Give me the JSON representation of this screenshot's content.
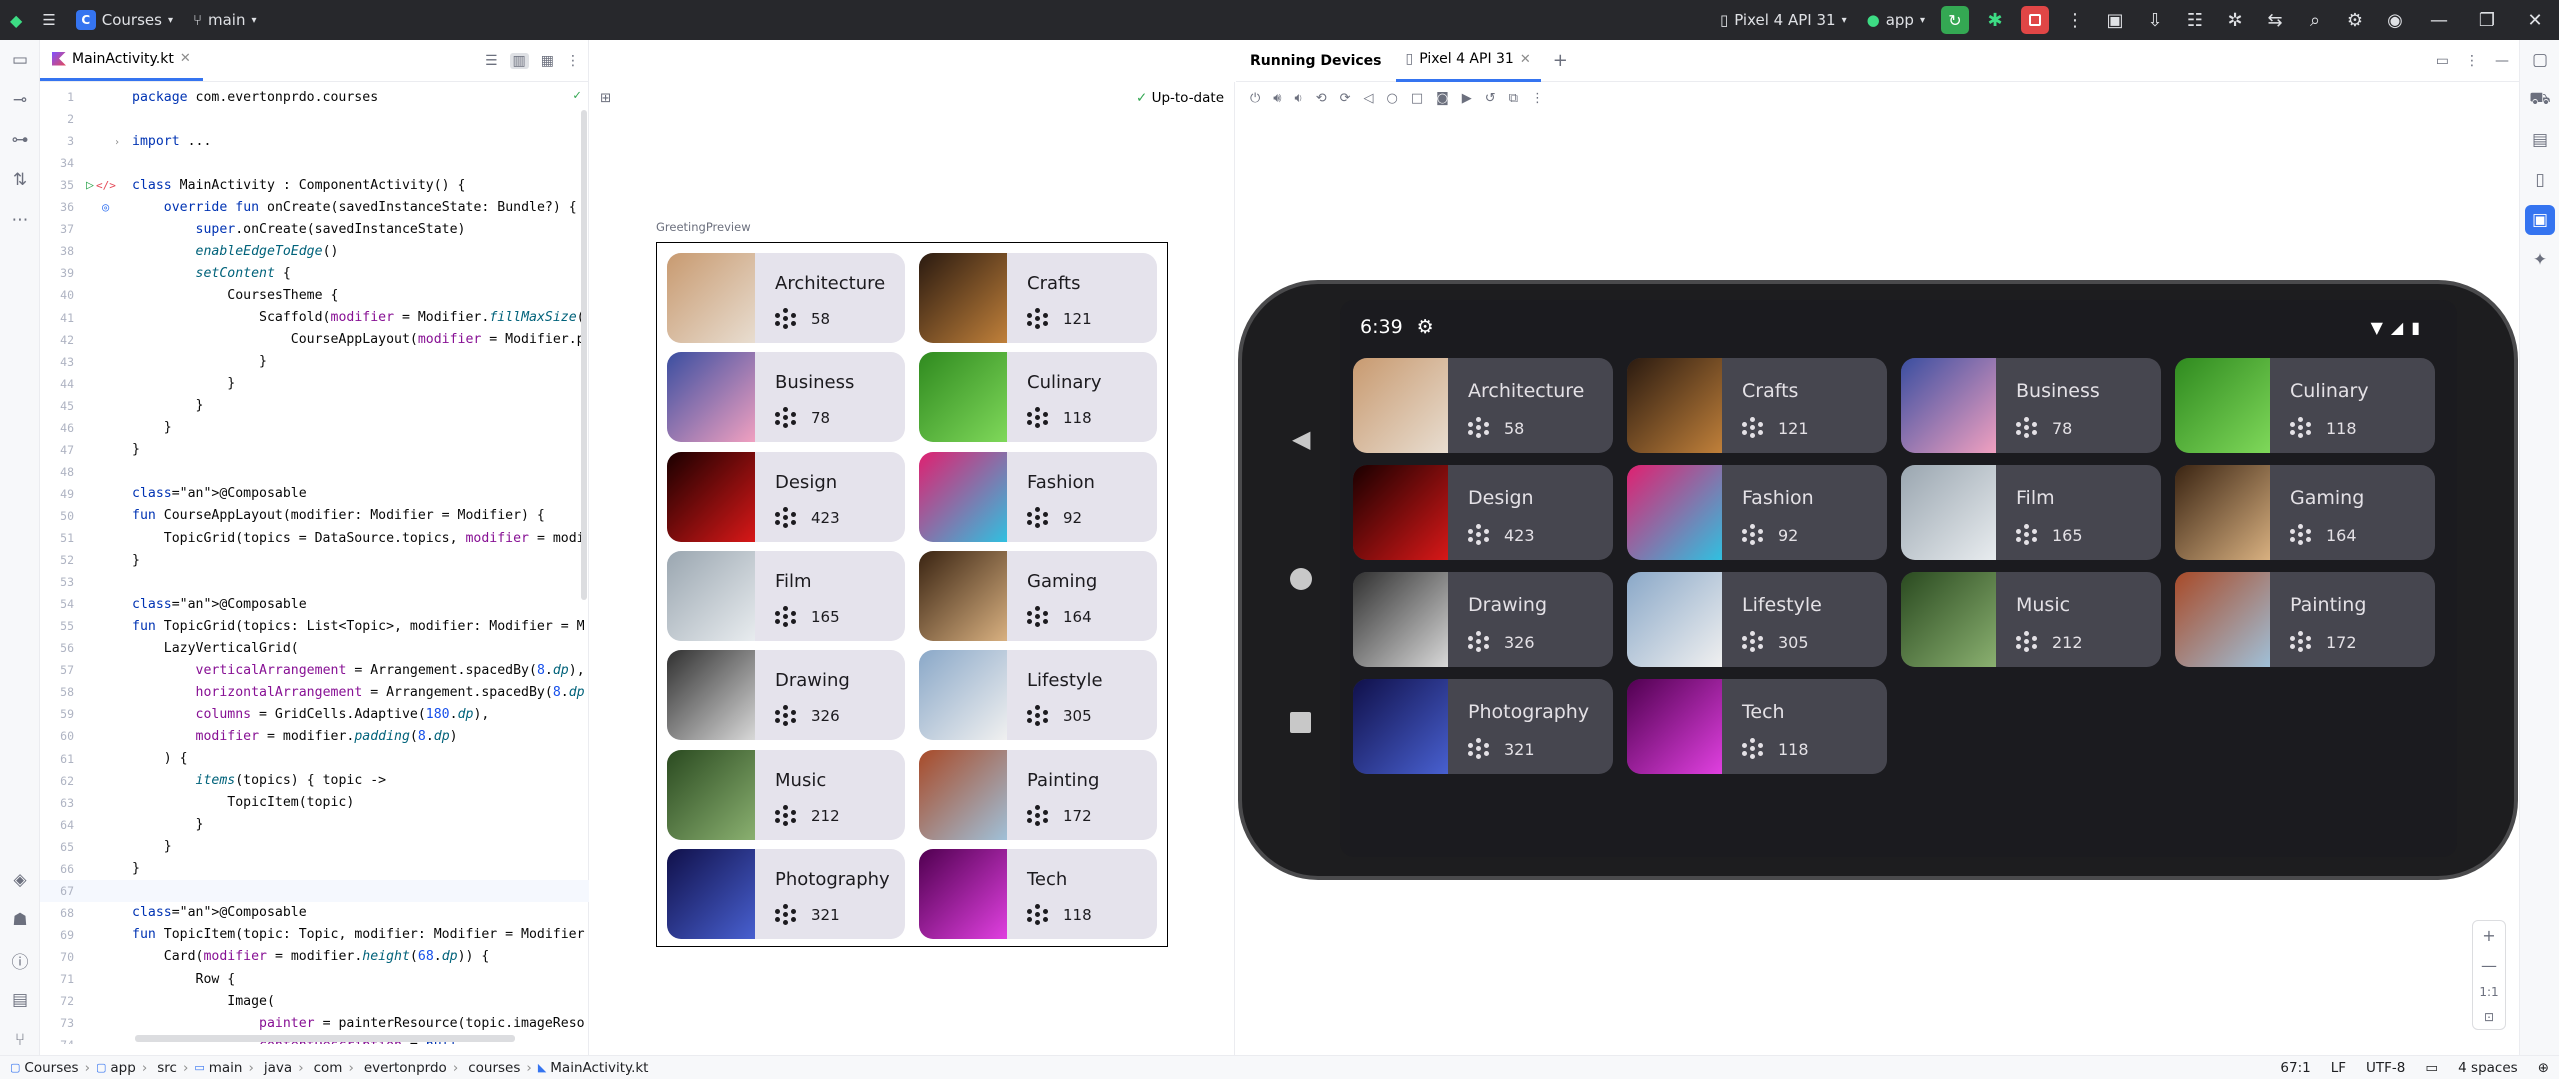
{
  "titlebar": {
    "project_letter": "C",
    "project": "Courses",
    "branch": "main",
    "device": "Pixel 4 API 31",
    "run_config": "app"
  },
  "editor": {
    "tab": "MainActivity.kt",
    "lines": [
      {
        "n": "1",
        "t": "package com.evertonprdo.courses"
      },
      {
        "n": "2",
        "t": ""
      },
      {
        "n": "3",
        "t": "import ..."
      },
      {
        "n": "34",
        "t": ""
      },
      {
        "n": "35",
        "t": "class MainActivity : ComponentActivity() {"
      },
      {
        "n": "36",
        "t": "    override fun onCreate(savedInstanceState: Bundle?) {"
      },
      {
        "n": "37",
        "t": "        super.onCreate(savedInstanceState)"
      },
      {
        "n": "38",
        "t": "        enableEdgeToEdge()"
      },
      {
        "n": "39",
        "t": "        setContent {"
      },
      {
        "n": "40",
        "t": "            CoursesTheme {"
      },
      {
        "n": "41",
        "t": "                Scaffold(modifier = Modifier.fillMaxSize("
      },
      {
        "n": "42",
        "t": "                    CourseAppLayout(modifier = Modifier.p"
      },
      {
        "n": "43",
        "t": "                }"
      },
      {
        "n": "44",
        "t": "            }"
      },
      {
        "n": "45",
        "t": "        }"
      },
      {
        "n": "46",
        "t": "    }"
      },
      {
        "n": "47",
        "t": "}"
      },
      {
        "n": "48",
        "t": ""
      },
      {
        "n": "49",
        "t": "@Composable"
      },
      {
        "n": "50",
        "t": "fun CourseAppLayout(modifier: Modifier = Modifier) {"
      },
      {
        "n": "51",
        "t": "    TopicGrid(topics = DataSource.topics, modifier = modi"
      },
      {
        "n": "52",
        "t": "}"
      },
      {
        "n": "53",
        "t": ""
      },
      {
        "n": "54",
        "t": "@Composable"
      },
      {
        "n": "55",
        "t": "fun TopicGrid(topics: List<Topic>, modifier: Modifier = M"
      },
      {
        "n": "56",
        "t": "    LazyVerticalGrid("
      },
      {
        "n": "57",
        "t": "        verticalArrangement = Arrangement.spacedBy(8.dp),"
      },
      {
        "n": "58",
        "t": "        horizontalArrangement = Arrangement.spacedBy(8.dp"
      },
      {
        "n": "59",
        "t": "        columns = GridCells.Adaptive(180.dp),"
      },
      {
        "n": "60",
        "t": "        modifier = modifier.padding(8.dp)"
      },
      {
        "n": "61",
        "t": "    ) {"
      },
      {
        "n": "62",
        "t": "        items(topics) { topic ->"
      },
      {
        "n": "63",
        "t": "            TopicItem(topic)"
      },
      {
        "n": "64",
        "t": "        }"
      },
      {
        "n": "65",
        "t": "    }"
      },
      {
        "n": "66",
        "t": "}"
      },
      {
        "n": "67",
        "t": ""
      },
      {
        "n": "68",
        "t": "@Composable"
      },
      {
        "n": "69",
        "t": "fun TopicItem(topic: Topic, modifier: Modifier = Modifier"
      },
      {
        "n": "70",
        "t": "    Card(modifier = modifier.height(68.dp)) {"
      },
      {
        "n": "71",
        "t": "        Row {"
      },
      {
        "n": "72",
        "t": "            Image("
      },
      {
        "n": "73",
        "t": "                painter = painterResource(topic.imageReso"
      },
      {
        "n": "74",
        "t": "                contentDescription = null,"
      }
    ]
  },
  "preview": {
    "status": "Up-to-date",
    "label": "GreetingPreview"
  },
  "devices": {
    "title": "Running Devices",
    "tab": "Pixel 4 API 31",
    "time": "6:39"
  },
  "topics": [
    {
      "name": "Architecture",
      "count": "58",
      "colors": [
        "#c89a70",
        "#e8ddd0"
      ]
    },
    {
      "name": "Crafts",
      "count": "121",
      "colors": [
        "#2a1a10",
        "#c0803a"
      ]
    },
    {
      "name": "Business",
      "count": "78",
      "colors": [
        "#3a4ea0",
        "#f0a0c0"
      ]
    },
    {
      "name": "Culinary",
      "count": "118",
      "colors": [
        "#2f8a1f",
        "#7fd85a"
      ]
    },
    {
      "name": "Design",
      "count": "423",
      "colors": [
        "#1a0000",
        "#d81818"
      ]
    },
    {
      "name": "Fashion",
      "count": "92",
      "colors": [
        "#e02070",
        "#30c0e0"
      ]
    },
    {
      "name": "Film",
      "count": "165",
      "colors": [
        "#9aa6b0",
        "#e8ecef"
      ]
    },
    {
      "name": "Gaming",
      "count": "164",
      "colors": [
        "#3a2412",
        "#d8b080"
      ]
    },
    {
      "name": "Drawing",
      "count": "326",
      "colors": [
        "#303030",
        "#d8d8d8"
      ]
    },
    {
      "name": "Lifestyle",
      "count": "305",
      "colors": [
        "#8aa8c8",
        "#f0f0f0"
      ]
    },
    {
      "name": "Music",
      "count": "212",
      "colors": [
        "#2a4a20",
        "#8ab070"
      ]
    },
    {
      "name": "Painting",
      "count": "172",
      "colors": [
        "#a84a28",
        "#a0c0d8"
      ]
    },
    {
      "name": "Photography",
      "count": "321",
      "colors": [
        "#10104a",
        "#4860d0"
      ]
    },
    {
      "name": "Tech",
      "count": "118",
      "colors": [
        "#500050",
        "#e040e0"
      ]
    }
  ],
  "statusbar": {
    "crumbs": [
      "Courses",
      "app",
      "src",
      "main",
      "java",
      "com",
      "evertonprdo",
      "courses",
      "MainActivity.kt"
    ],
    "position": "67:1",
    "line_sep": "LF",
    "encoding": "UTF-8",
    "indent": "4 spaces"
  },
  "zoom": {
    "reset": "1:1"
  }
}
